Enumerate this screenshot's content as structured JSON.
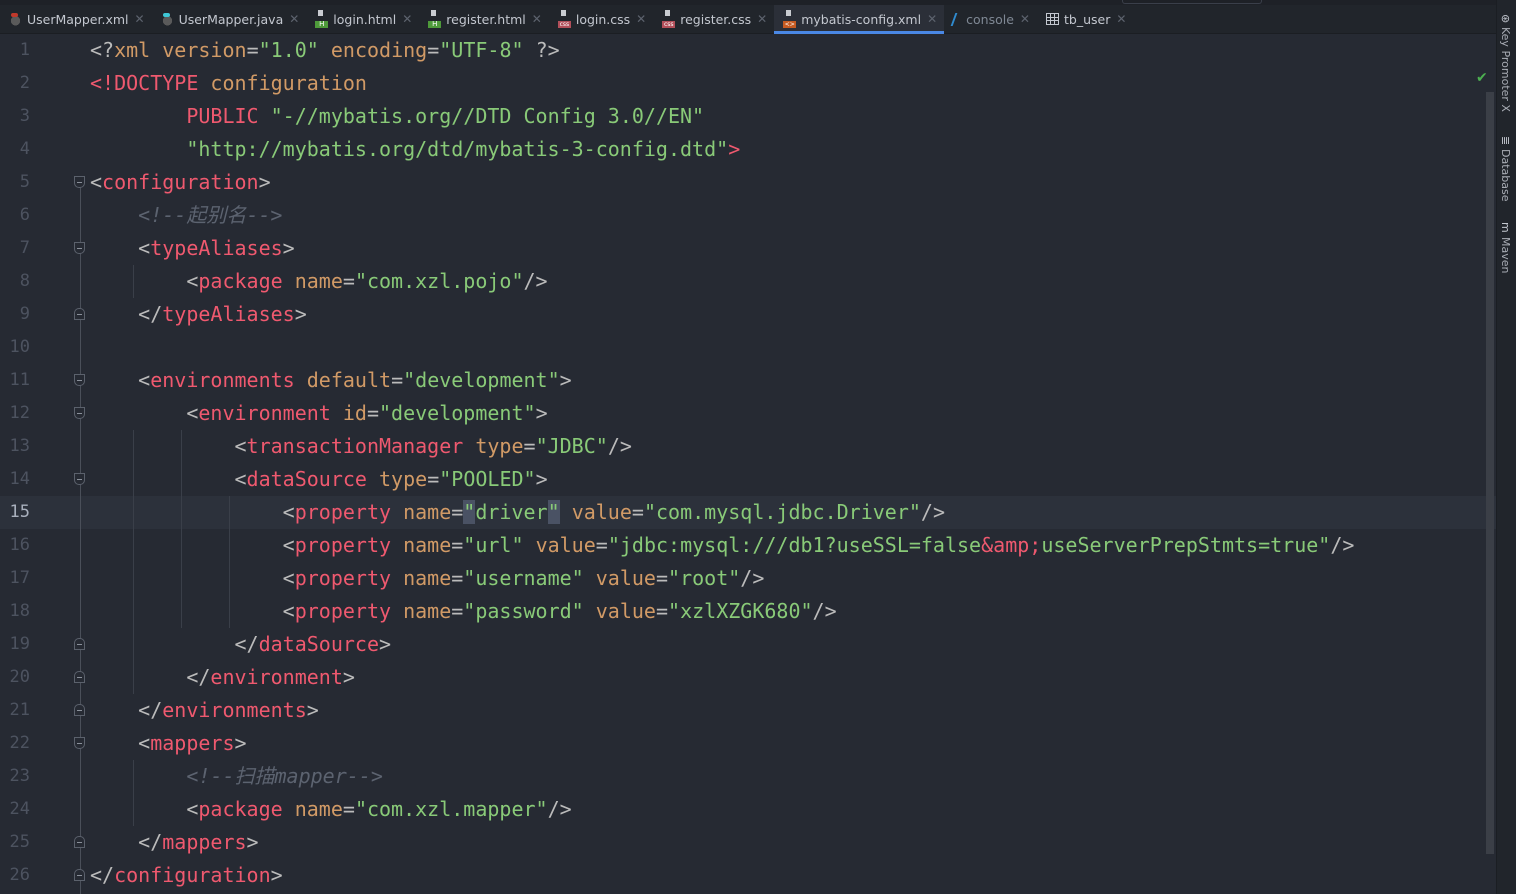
{
  "tabs": [
    {
      "label": "UserMapper.xml",
      "icon": "mybatis-xml-icon",
      "cls": "java"
    },
    {
      "label": "UserMapper.java",
      "icon": "mybatis-java-icon",
      "cls": "java j2"
    },
    {
      "label": "login.html",
      "icon": "html-file-icon",
      "cls": "file html"
    },
    {
      "label": "register.html",
      "icon": "html-file-icon",
      "cls": "file html"
    },
    {
      "label": "login.css",
      "icon": "css-file-icon",
      "cls": "file css"
    },
    {
      "label": "register.css",
      "icon": "css-file-icon",
      "cls": "file css"
    },
    {
      "label": "mybatis-config.xml",
      "icon": "xml-file-icon",
      "cls": "file xml",
      "active": true
    },
    {
      "label": "console",
      "icon": "console-icon",
      "cls": "console",
      "dim": true
    },
    {
      "label": "tb_user",
      "icon": "table-icon",
      "cls": "table"
    }
  ],
  "close_glyph": "✕",
  "right_tools": [
    {
      "label": "Key Promoter X",
      "icon": "key-promoter-icon",
      "glyph": "⊛"
    },
    {
      "label": "Database",
      "icon": "database-icon",
      "glyph": "≣"
    },
    {
      "label": "Maven",
      "icon": "maven-icon",
      "glyph": "m"
    }
  ],
  "status_check": "✔",
  "current_line": 15,
  "lines": [
    {
      "n": "1",
      "t": [
        [
          "b",
          "<?"
        ],
        [
          "a",
          "xml"
        ],
        [
          "b",
          " "
        ],
        [
          "a",
          "version"
        ],
        [
          "b",
          "="
        ],
        [
          "s",
          "\"1.0\""
        ],
        [
          "b",
          " "
        ],
        [
          "a",
          "encoding"
        ],
        [
          "b",
          "="
        ],
        [
          "s",
          "\"UTF-8\""
        ],
        [
          "b",
          " ?>"
        ]
      ]
    },
    {
      "n": "2",
      "t": [
        [
          "t",
          "<!DOCTYPE"
        ],
        [
          "b",
          " "
        ],
        [
          "a",
          "configuration"
        ]
      ]
    },
    {
      "n": "3",
      "t": [
        [
          "b",
          "        "
        ],
        [
          "t",
          "PUBLIC"
        ],
        [
          "b",
          " "
        ],
        [
          "s",
          "\"-//mybatis.org//DTD Config 3.0//EN\""
        ]
      ]
    },
    {
      "n": "4",
      "t": [
        [
          "b",
          "        "
        ],
        [
          "s",
          "\"http://mybatis.org/dtd/mybatis-3-config.dtd\""
        ],
        [
          "t",
          ">"
        ]
      ]
    },
    {
      "n": "5",
      "f": "open",
      "t": [
        [
          "b",
          "<"
        ],
        [
          "t",
          "configuration"
        ],
        [
          "b",
          ">"
        ]
      ]
    },
    {
      "n": "6",
      "t": [
        [
          "c",
          "    <!--起别名-->"
        ]
      ]
    },
    {
      "n": "7",
      "f": "open",
      "t": [
        [
          "b",
          "    <"
        ],
        [
          "t",
          "typeAliases"
        ],
        [
          "b",
          ">"
        ]
      ]
    },
    {
      "n": "8",
      "t": [
        [
          "b",
          "        <"
        ],
        [
          "t",
          "package"
        ],
        [
          "b",
          " "
        ],
        [
          "a",
          "name"
        ],
        [
          "b",
          "="
        ],
        [
          "s",
          "\"com.xzl.pojo\""
        ],
        [
          "b",
          "/>"
        ]
      ]
    },
    {
      "n": "9",
      "f": "close",
      "t": [
        [
          "b",
          "    </"
        ],
        [
          "t",
          "typeAliases"
        ],
        [
          "b",
          ">"
        ]
      ]
    },
    {
      "n": "10",
      "t": []
    },
    {
      "n": "11",
      "f": "open",
      "t": [
        [
          "b",
          "    <"
        ],
        [
          "t",
          "environments"
        ],
        [
          "b",
          " "
        ],
        [
          "a",
          "default"
        ],
        [
          "b",
          "="
        ],
        [
          "s",
          "\"development\""
        ],
        [
          "b",
          ">"
        ]
      ]
    },
    {
      "n": "12",
      "f": "open",
      "t": [
        [
          "b",
          "        <"
        ],
        [
          "t",
          "environment"
        ],
        [
          "b",
          " "
        ],
        [
          "a",
          "id"
        ],
        [
          "b",
          "="
        ],
        [
          "s",
          "\"development\""
        ],
        [
          "b",
          ">"
        ]
      ]
    },
    {
      "n": "13",
      "t": [
        [
          "b",
          "            <"
        ],
        [
          "t",
          "transactionManager"
        ],
        [
          "b",
          " "
        ],
        [
          "a",
          "type"
        ],
        [
          "b",
          "="
        ],
        [
          "s",
          "\"JDBC\""
        ],
        [
          "b",
          "/>"
        ]
      ]
    },
    {
      "n": "14",
      "f": "open",
      "t": [
        [
          "b",
          "            <"
        ],
        [
          "t",
          "dataSource"
        ],
        [
          "b",
          " "
        ],
        [
          "a",
          "type"
        ],
        [
          "b",
          "="
        ],
        [
          "s",
          "\"POOLED\""
        ],
        [
          "b",
          ">"
        ]
      ]
    },
    {
      "n": "15",
      "t": [
        [
          "b",
          "                <"
        ],
        [
          "t",
          "property"
        ],
        [
          "b",
          " "
        ],
        [
          "a",
          "name"
        ],
        [
          "b",
          "="
        ],
        [
          "h",
          "\""
        ],
        [
          "s",
          "driver"
        ],
        [
          "h",
          "\""
        ],
        [
          "b",
          " "
        ],
        [
          "a",
          "value"
        ],
        [
          "b",
          "="
        ],
        [
          "s",
          "\"com.mysql.jdbc.Driver\""
        ],
        [
          "b",
          "/>"
        ]
      ]
    },
    {
      "n": "16",
      "t": [
        [
          "b",
          "                <"
        ],
        [
          "t",
          "property"
        ],
        [
          "b",
          " "
        ],
        [
          "a",
          "name"
        ],
        [
          "b",
          "="
        ],
        [
          "s",
          "\"url\""
        ],
        [
          "b",
          " "
        ],
        [
          "a",
          "value"
        ],
        [
          "b",
          "="
        ],
        [
          "s",
          "\"jdbc:mysql:///db1?useSSL=false"
        ],
        [
          "e",
          "&amp;"
        ],
        [
          "s",
          "useServerPrepStmts=true\""
        ],
        [
          "b",
          "/>"
        ]
      ]
    },
    {
      "n": "17",
      "t": [
        [
          "b",
          "                <"
        ],
        [
          "t",
          "property"
        ],
        [
          "b",
          " "
        ],
        [
          "a",
          "name"
        ],
        [
          "b",
          "="
        ],
        [
          "s",
          "\"username\""
        ],
        [
          "b",
          " "
        ],
        [
          "a",
          "value"
        ],
        [
          "b",
          "="
        ],
        [
          "s",
          "\"root\""
        ],
        [
          "b",
          "/>"
        ]
      ]
    },
    {
      "n": "18",
      "t": [
        [
          "b",
          "                <"
        ],
        [
          "t",
          "property"
        ],
        [
          "b",
          " "
        ],
        [
          "a",
          "name"
        ],
        [
          "b",
          "="
        ],
        [
          "s",
          "\"password\""
        ],
        [
          "b",
          " "
        ],
        [
          "a",
          "value"
        ],
        [
          "b",
          "="
        ],
        [
          "s",
          "\"xzlXZGK680\""
        ],
        [
          "b",
          "/>"
        ]
      ]
    },
    {
      "n": "19",
      "f": "close",
      "t": [
        [
          "b",
          "            </"
        ],
        [
          "t",
          "dataSource"
        ],
        [
          "b",
          ">"
        ]
      ]
    },
    {
      "n": "20",
      "f": "close",
      "t": [
        [
          "b",
          "        </"
        ],
        [
          "t",
          "environment"
        ],
        [
          "b",
          ">"
        ]
      ]
    },
    {
      "n": "21",
      "f": "close",
      "t": [
        [
          "b",
          "    </"
        ],
        [
          "t",
          "environments"
        ],
        [
          "b",
          ">"
        ]
      ]
    },
    {
      "n": "22",
      "f": "open",
      "t": [
        [
          "b",
          "    <"
        ],
        [
          "t",
          "mappers"
        ],
        [
          "b",
          ">"
        ]
      ]
    },
    {
      "n": "23",
      "t": [
        [
          "c",
          "        <!--扫描mapper-->"
        ]
      ]
    },
    {
      "n": "24",
      "t": [
        [
          "b",
          "        <"
        ],
        [
          "t",
          "package"
        ],
        [
          "b",
          " "
        ],
        [
          "a",
          "name"
        ],
        [
          "b",
          "="
        ],
        [
          "s",
          "\"com.xzl.mapper\""
        ],
        [
          "b",
          "/>"
        ]
      ]
    },
    {
      "n": "25",
      "f": "close",
      "t": [
        [
          "b",
          "    </"
        ],
        [
          "t",
          "mappers"
        ],
        [
          "b",
          ">"
        ]
      ]
    },
    {
      "n": "26",
      "f": "close",
      "t": [
        [
          "b",
          "</"
        ],
        [
          "t",
          "configuration"
        ],
        [
          "b",
          ">"
        ]
      ]
    }
  ]
}
